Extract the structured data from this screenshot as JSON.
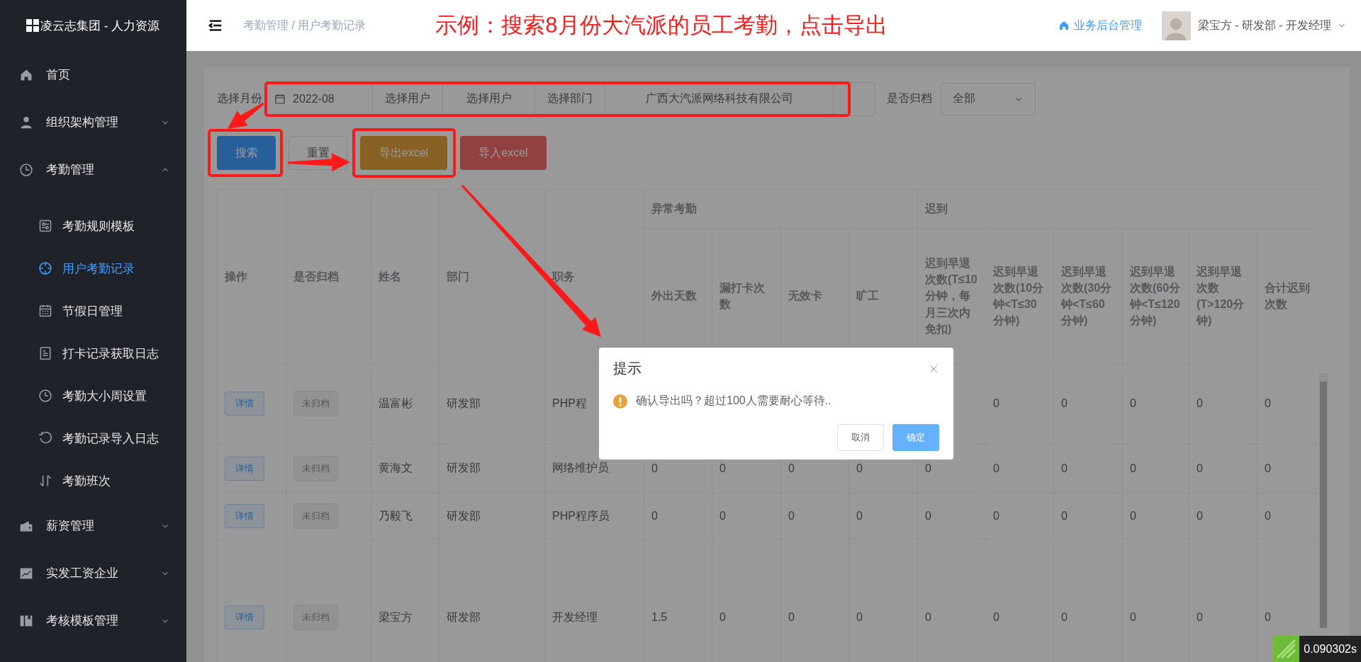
{
  "sidebar": {
    "logo": "凌云志集团 - 人力资源",
    "items": [
      {
        "label": "首页",
        "kind": "link"
      },
      {
        "label": "组织架构管理",
        "kind": "group",
        "expanded": false
      },
      {
        "label": "考勤管理",
        "kind": "group",
        "expanded": true,
        "children": [
          {
            "label": "考勤规则模板",
            "selected": false
          },
          {
            "label": "用户考勤记录",
            "selected": true
          },
          {
            "label": "节假日管理",
            "selected": false
          },
          {
            "label": "打卡记录获取日志",
            "selected": false
          },
          {
            "label": "考勤大小周设置",
            "selected": false
          },
          {
            "label": "考勤记录导入日志",
            "selected": false
          },
          {
            "label": "考勤班次",
            "selected": false
          }
        ]
      },
      {
        "label": "薪资管理",
        "kind": "group",
        "expanded": false
      },
      {
        "label": "实发工资企业",
        "kind": "group",
        "expanded": false
      },
      {
        "label": "考核模板管理",
        "kind": "group",
        "expanded": false
      }
    ]
  },
  "header": {
    "breadcrumb": "考勤管理 / 用户考勤记录",
    "annotation": "示例：搜索8月份大汽派的员工考勤，点击导出",
    "link": "业务后台管理",
    "user": "梁宝方 - 研发部 - 开发经理"
  },
  "filters": {
    "month_label": "选择月份",
    "segments": [
      "2022-08",
      "选择用户",
      "选择用户",
      "选择部门",
      "广西大汽派网络科技有限公司"
    ],
    "archive_label": "是否归档",
    "archive_value": "全部"
  },
  "buttons": [
    {
      "label": "搜索",
      "kind": "primary"
    },
    {
      "label": "重置",
      "kind": "default"
    },
    {
      "label": "导出excel",
      "kind": "warning"
    },
    {
      "label": "导入excel",
      "kind": "danger"
    }
  ],
  "table": {
    "columns": [
      "操作",
      "是否归档",
      "姓名",
      "部门",
      "职务"
    ],
    "groups": [
      {
        "label": "异常考勤",
        "columns": [
          "外出天数",
          "漏打卡次数",
          "无效卡",
          "旷工"
        ]
      },
      {
        "label": "迟到",
        "columns": [
          "迟到早退次数(T≤10分钟，每月三次内免扣)",
          "迟到早退次数(10分钟<T≤30分钟)",
          "迟到早退次数(30分钟<T≤60分钟)",
          "迟到早退次数(60分钟<T≤120分钟)",
          "迟到早退次数(T>120分钟)",
          "合计迟到次数"
        ]
      }
    ],
    "rows": [
      {
        "action": "详情",
        "archive": "未归档",
        "archived": false,
        "name": "温富彬",
        "department": "研发部",
        "position": "PHP程",
        "values": [
          "0",
          "0",
          "0",
          "0",
          "0"
        ]
      },
      {
        "action": "详情",
        "archive": "未归档",
        "archived": false,
        "name": "黄海文",
        "department": "研发部",
        "position": "网络维护员",
        "values": [
          "0",
          "0",
          "0",
          "0",
          "0",
          "0",
          "0",
          "0",
          "0",
          "0"
        ]
      },
      {
        "action": "详情",
        "archive": "未归档",
        "archived": false,
        "name": "乃毅飞",
        "department": "研发部",
        "position": "PHP程序员",
        "values": [
          "0",
          "0",
          "0",
          "0",
          "0",
          "0",
          "0",
          "0",
          "0",
          "0"
        ]
      },
      {
        "action": "详情",
        "archive": "未归档",
        "archived": false,
        "name": "梁宝方",
        "department": "研发部",
        "position": "开发经理",
        "values": [
          "1.5",
          "0",
          "0",
          "0",
          "0",
          "0",
          "0",
          "0",
          "0",
          "0"
        ]
      }
    ]
  },
  "dialog": {
    "title": "提示",
    "message": "确认导出吗？超过100人需要耐心等待..",
    "buttons": [
      {
        "label": "取消",
        "kind": "default"
      },
      {
        "label": "确定",
        "kind": "primary"
      }
    ]
  },
  "timer": "0.090302s"
}
